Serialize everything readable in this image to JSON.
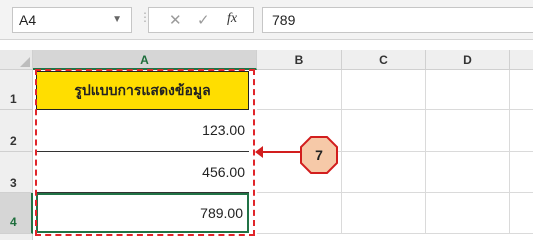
{
  "formula_bar": {
    "name_box": "A4",
    "name_box_arrow": "▼",
    "separator": "⋮",
    "cancel_icon": "✕",
    "enter_icon": "✓",
    "fx_label": "fx",
    "formula_value": "789"
  },
  "columns": [
    "A",
    "B",
    "C",
    "D"
  ],
  "rows": [
    "1",
    "2",
    "3",
    "4"
  ],
  "cells": {
    "A1": "รูปแบบการแสดงข้อมูล",
    "A2": "123.00",
    "A3": "456.00",
    "A4": "789.00"
  },
  "callout": {
    "number": "7"
  },
  "colors": {
    "header_fill": "#ffde00",
    "selection_green": "#217346",
    "marquee_red": "#e0252a",
    "badge_fill": "#f6c9a8",
    "badge_stroke": "#d21e1e"
  }
}
